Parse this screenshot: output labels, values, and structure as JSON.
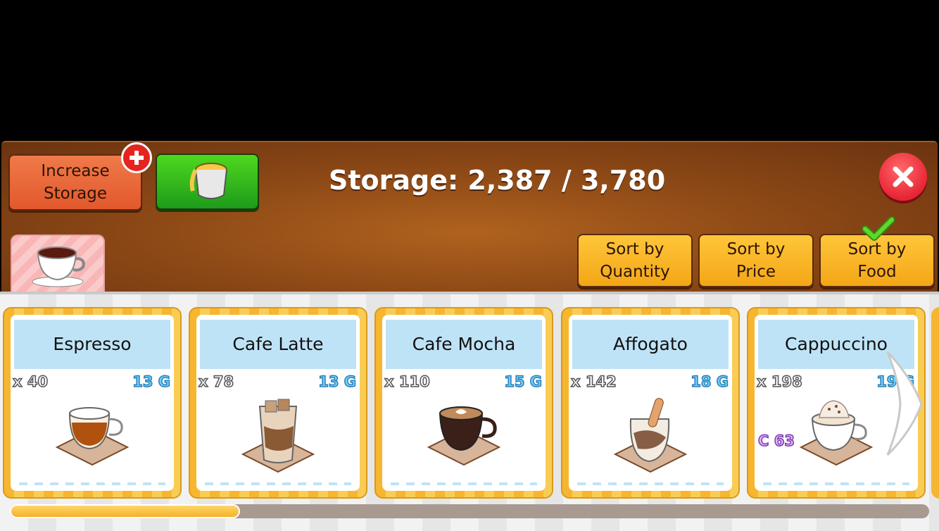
{
  "header": {
    "increase_storage_label": "Increase Storage",
    "storage_text": "Storage: 2,387 / 3,780"
  },
  "sort_buttons": [
    {
      "label": "Sort by Quantity",
      "selected": false
    },
    {
      "label": "Sort by Price",
      "selected": false
    },
    {
      "label": "Sort by Food",
      "selected": true
    }
  ],
  "items": [
    {
      "name": "Espresso",
      "quantity": "x 40",
      "price": "13 G"
    },
    {
      "name": "Cafe Latte",
      "quantity": "x 78",
      "price": "13 G"
    },
    {
      "name": "Cafe Mocha",
      "quantity": "x 110",
      "price": "15 G"
    },
    {
      "name": "Affogato",
      "quantity": "x 142",
      "price": "18 G"
    },
    {
      "name": "Cappuccino",
      "quantity": "x 198",
      "price": "19 G",
      "chef_badge": "C 63"
    }
  ],
  "scroll_progress": 0.25,
  "colors": {
    "accent_orange": "#e2582c",
    "accent_green": "#1e9b1a",
    "card_gold": "#f7b630",
    "name_blue": "#bfe3f6"
  }
}
